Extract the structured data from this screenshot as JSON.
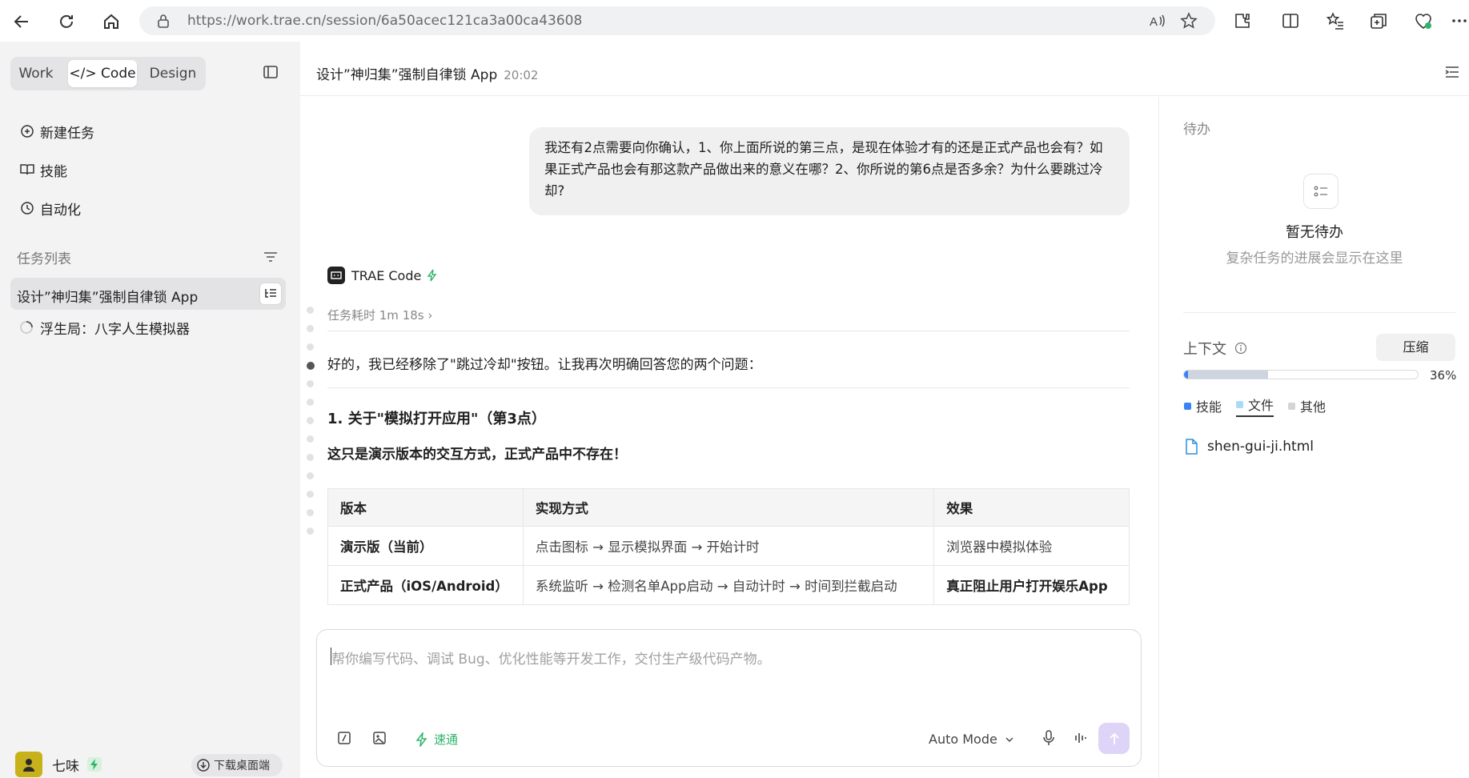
{
  "browser": {
    "url": "https://work.trae.cn/session/6a50acec121ca3a00ca43608"
  },
  "sidebar": {
    "modes": [
      "Work",
      "</> Code",
      "Design"
    ],
    "active_mode": "</> Code",
    "nav": [
      {
        "label": "新建任务",
        "icon": "new-task-icon"
      },
      {
        "label": "技能",
        "icon": "skills-icon"
      },
      {
        "label": "自动化",
        "icon": "clock-icon"
      }
    ],
    "task_list_title": "任务列表",
    "tasks": [
      {
        "label": "设计”神归集”强制自律锁 App",
        "active": true
      },
      {
        "label": "浮生局：八字人生模拟器",
        "active": false,
        "loading": true
      }
    ],
    "user": {
      "name": "七味"
    },
    "download_label": "下载桌面端"
  },
  "header": {
    "title": "设计”神归集”强制自律锁 App",
    "time": "20:02"
  },
  "chat": {
    "user_message": "我还有2点需要向你确认，1、你上面所说的第三点，是现在体验才有的还是正式产品也会有？如果正式产品也会有那这款产品做出来的意义在哪？2、你所说的第6点是否多余？为什么要跳过冷却?",
    "agent_name": "TRAE Code",
    "elapsed": "任务耗时 1m 18s",
    "answer": "好的，我已经移除了\"跳过冷却\"按钮。让我再次明确回答您的两个问题：",
    "heading": "1. 关于\"模拟打开应用\"（第3点）",
    "bold_line": "这只是演示版本的交互方式，正式产品中不存在！",
    "table": {
      "headers": [
        "版本",
        "实现方式",
        "效果"
      ],
      "rows": [
        [
          "演示版（当前）",
          "点击图标 → 显示模拟界面 → 开始计时",
          "浏览器中模拟体验"
        ],
        [
          "正式产品（iOS/Android）",
          "系统监听 → 检测名单App启动 → 自动计时 → 时间到拦截启动",
          "真正阻止用户打开娱乐App"
        ]
      ]
    }
  },
  "composer": {
    "placeholder": "帮你编写代码、调试 Bug、优化性能等开发工作，交付生产级代码产物。",
    "fast_label": "速通",
    "mode_label": "Auto Mode"
  },
  "right_panel": {
    "todo_title": "待办",
    "empty_title": "暂无待办",
    "empty_subtitle": "复杂任务的进展会显示在这里",
    "context_title": "上下文",
    "compress_label": "压缩",
    "context_usage_pct": 36,
    "context_usage_label": "36%",
    "legend": [
      {
        "label": "技能",
        "color": "#3b82f6"
      },
      {
        "label": "文件",
        "color": "#a9dcf4",
        "selected": true
      },
      {
        "label": "其他",
        "color": "#d4d4d8"
      }
    ],
    "file": "shen-gui-ji.html"
  },
  "colors": {
    "accent_green": "#2fb36a",
    "send_button": "#ddd4f7"
  }
}
